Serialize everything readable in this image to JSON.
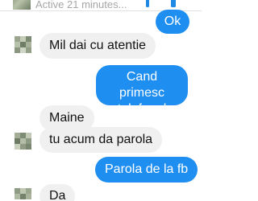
{
  "header": {
    "status": "Active 21 minutes...",
    "accent_color": "#1e88e5",
    "icons": [
      "phone-icon",
      "video-icon"
    ]
  },
  "messages": [
    {
      "side": "sent",
      "text": "Ok"
    },
    {
      "side": "received",
      "text": "Mil dai cu atentie"
    },
    {
      "side": "sent",
      "text": "Cand primesc telefonul"
    },
    {
      "side": "received",
      "text": "Maine"
    },
    {
      "side": "received",
      "text": "tu acum da parola"
    },
    {
      "side": "sent",
      "text": "Parola de la fb"
    },
    {
      "side": "received",
      "text": "Da"
    }
  ],
  "colors": {
    "sent_bubble": "#1f8ef1",
    "received_bubble": "#f0f0f0"
  }
}
